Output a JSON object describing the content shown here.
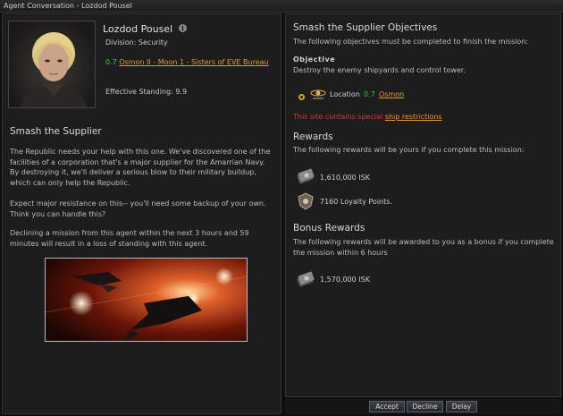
{
  "window": {
    "title": "Agent Conversation - Lozdod Pousel"
  },
  "agent": {
    "name": "Lozdod Pousel",
    "info_icon": "i",
    "division": "Division: Security",
    "location_security": "0.7",
    "location_name": "Osmon II - Moon 1 - Sisters of EVE Bureau",
    "standing": "Effective Standing: 9.9"
  },
  "mission": {
    "title": "Smash the Supplier",
    "paragraphs": [
      "The Republic needs your help with this one. We've discovered one of the facilities of a corporation that's a major supplier for the Amarrian Navy. By destroying it, we'll deliver a serious blow to their military buildup, which can only help the Republic.",
      "Expect major resistance on this-- you'll need some backup of your own. Think you can handle this?",
      "Declining a mission from this agent within the next 3 hours and 59 minutes will result in a loss of standing with this agent."
    ]
  },
  "objectives": {
    "title": "Smash the Supplier Objectives",
    "subtitle": "The following objectives must be completed to finish the mission:",
    "heading": "Objective",
    "description": "Destroy the enemy shipyards and control tower.",
    "location_label": "Location",
    "location_security": "0.7",
    "location_name": "Osmon",
    "warning_prefix": "This site contains special ",
    "warning_link": "ship restrictions"
  },
  "rewards": {
    "title": "Rewards",
    "subtitle": "The following rewards will be yours if you complete this mission:",
    "isk": "1,610,000 ISK",
    "loyalty": "7160 Loyalty Points."
  },
  "bonus": {
    "title": "Bonus Rewards",
    "subtitle": "The following rewards will be awarded to you as a bonus if you complete the mission within 6 hours",
    "isk": "1,570,000 ISK"
  },
  "buttons": {
    "accept": "Accept",
    "decline": "Decline",
    "delay": "Delay"
  },
  "colors": {
    "security": "#2fcf3c",
    "link": "#e39a2a",
    "warning": "#d23b3b"
  }
}
